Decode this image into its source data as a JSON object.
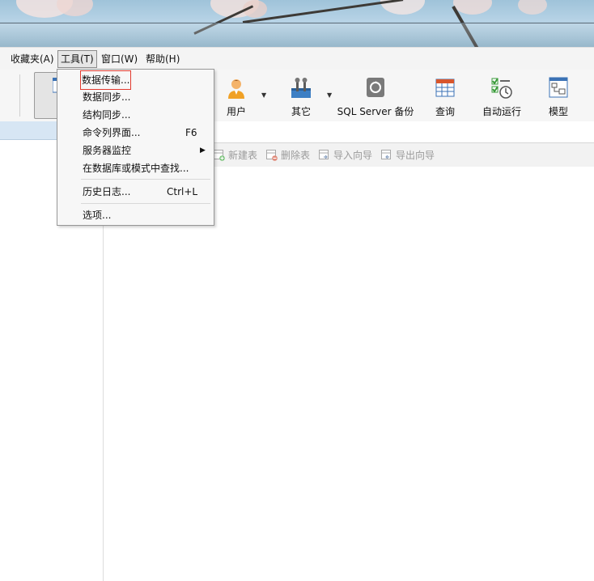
{
  "menubar": {
    "items": [
      {
        "label": "收藏夹(A)",
        "name": "menu-favorites",
        "active": false
      },
      {
        "label": "工具(T)",
        "name": "menu-tools",
        "active": true
      },
      {
        "label": "窗口(W)",
        "name": "menu-window",
        "active": false
      },
      {
        "label": "帮助(H)",
        "name": "menu-help",
        "active": false
      }
    ]
  },
  "toolbar": {
    "buttons": [
      {
        "label": "用户",
        "icon": "user-icon",
        "has_dropdown": true
      },
      {
        "label": "其它",
        "icon": "tools-icon",
        "has_dropdown": true
      },
      {
        "label": "SQL Server 备份",
        "icon": "backup-icon",
        "has_dropdown": false
      },
      {
        "label": "查询",
        "icon": "query-icon",
        "has_dropdown": false
      },
      {
        "label": "自动运行",
        "icon": "schedule-icon",
        "has_dropdown": false
      },
      {
        "label": "模型",
        "icon": "model-icon",
        "has_dropdown": false
      }
    ]
  },
  "object_toolbar": {
    "buttons": [
      {
        "label": "新建表",
        "icon": "new-table-icon"
      },
      {
        "label": "删除表",
        "icon": "delete-table-icon"
      },
      {
        "label": "导入向导",
        "icon": "import-wizard-icon"
      },
      {
        "label": "导出向导",
        "icon": "export-wizard-icon"
      }
    ]
  },
  "tools_menu": {
    "items": [
      {
        "label": "数据传输...",
        "shortcut": "",
        "submenu": false,
        "highlighted": true
      },
      {
        "label": "数据同步...",
        "shortcut": "",
        "submenu": false,
        "highlighted": false
      },
      {
        "label": "结构同步...",
        "shortcut": "",
        "submenu": false,
        "highlighted": false
      },
      {
        "label": "命令列界面...",
        "shortcut": "F6",
        "submenu": false,
        "highlighted": false
      },
      {
        "label": "服务器监控",
        "shortcut": "",
        "submenu": true,
        "highlighted": false
      },
      {
        "label": "在数据库或模式中查找...",
        "shortcut": "",
        "submenu": false,
        "highlighted": false
      },
      {
        "label": "历史日志...",
        "shortcut": "Ctrl+L",
        "submenu": false,
        "highlighted": false
      },
      {
        "label": "选项...",
        "shortcut": "",
        "submenu": false,
        "highlighted": false
      }
    ]
  },
  "colors": {
    "accent_highlight": "#e23a2e",
    "menu_bg": "#f7f7f7",
    "selection_strip": "#d7e6f4"
  }
}
